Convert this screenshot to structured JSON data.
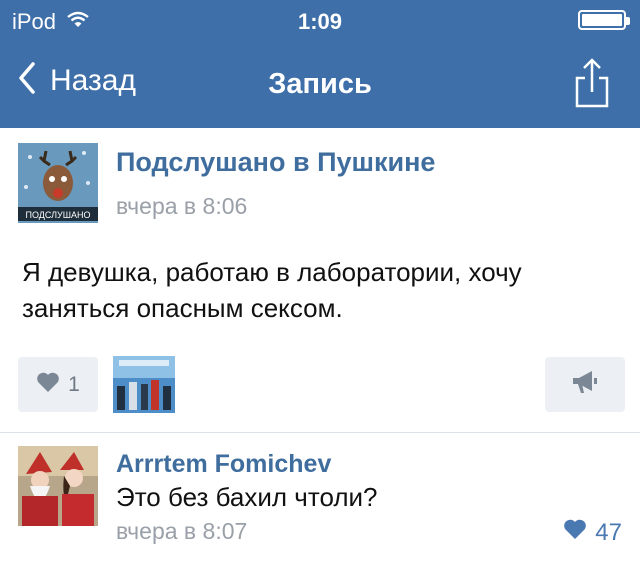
{
  "status_bar": {
    "carrier": "iPod",
    "time": "1:09",
    "wifi_icon": "wifi-icon",
    "battery_icon": "battery-icon"
  },
  "nav": {
    "back_label": "Назад",
    "title": "Запись",
    "back_icon": "chevron-left-icon",
    "share_icon": "share-icon"
  },
  "post": {
    "group_name": "Подслушано в Пушкине",
    "avatar_caption": "ПОДСЛУШАНО",
    "time": "вчера в 8:06",
    "text": "Я девушка, работаю в лаборатории, хочу заняться опасным сексом.",
    "likes": "1",
    "like_icon": "heart-icon",
    "repost_icon": "megaphone-icon"
  },
  "comment": {
    "author": "Arrrtem Fomichev",
    "text": "Это без бахил чтоли?",
    "time": "вчера в 8:07",
    "likes": "47",
    "like_icon": "heart-icon"
  },
  "colors": {
    "header_bg": "#3e6fa9",
    "link": "#3f6d9e",
    "meta_text": "#9aa0a8",
    "like_active": "#4a78b1",
    "button_bg": "#eceff3"
  }
}
